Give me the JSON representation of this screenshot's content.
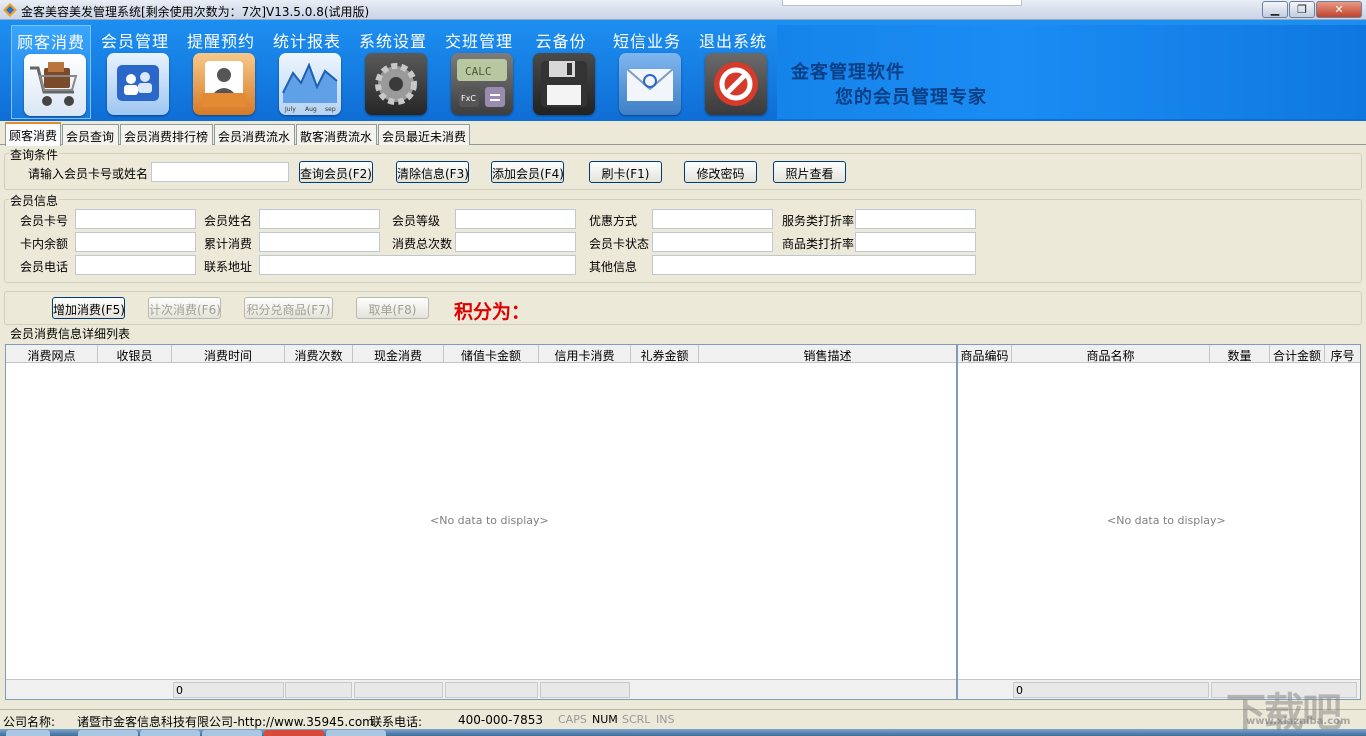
{
  "window": {
    "title": "金客美容美发管理系统[剩余使用次数为：7次]V13.5.0.8(试用版)"
  },
  "toolbar": {
    "items": [
      {
        "label": "顾客消费",
        "icon": "shopping-cart-icon"
      },
      {
        "label": "会员管理",
        "icon": "members-icon"
      },
      {
        "label": "提醒预约",
        "icon": "appointment-icon"
      },
      {
        "label": "统计报表",
        "icon": "chart-icon"
      },
      {
        "label": "系统设置",
        "icon": "gear-icon"
      },
      {
        "label": "交班管理",
        "icon": "calculator-icon"
      },
      {
        "label": "云备份",
        "icon": "floppy-disk-icon"
      },
      {
        "label": "短信业务",
        "icon": "envelope-icon"
      },
      {
        "label": "退出系统",
        "icon": "exit-icon"
      }
    ],
    "calc_text": "CALC",
    "calc_key": "FxC",
    "chart_months": [
      "July",
      "Aug",
      "sep"
    ]
  },
  "brand": {
    "line1": "金客管理软件",
    "line2": "您的会员管理专家"
  },
  "tabs": [
    "顾客消费",
    "会员查询",
    "会员消费排行榜",
    "会员消费流水",
    "散客消费流水",
    "会员最近未消费"
  ],
  "query": {
    "title": "查询条件",
    "prompt": "请输入会员卡号或姓名",
    "value": "",
    "buttons": [
      "查询会员(F2)",
      "清除信息(F3)",
      "添加会员(F4)",
      "刷卡(F1)",
      "修改密码",
      "照片查看"
    ]
  },
  "member": {
    "title": "会员信息",
    "labels": {
      "card_no": "会员卡号",
      "name": "会员姓名",
      "level": "会员等级",
      "discount_mode": "优惠方式",
      "service_rate": "服务类打折率",
      "balance": "卡内余额",
      "total_spent": "累计消费",
      "total_times": "消费总次数",
      "card_status": "会员卡状态",
      "goods_rate": "商品类打折率",
      "phone": "会员电话",
      "address": "联系地址",
      "other": "其他信息"
    }
  },
  "actions": {
    "buttons": [
      "增加消费(F5)",
      "计次消费(F6)",
      "积分兑商品(F7)",
      "取单(F8)"
    ],
    "points_label": "积分为："
  },
  "detail": {
    "title": "会员消费信息详细列表",
    "left_columns": [
      "消费网点",
      "收银员",
      "消费时间",
      "消费次数",
      "现金消费",
      "储值卡金额",
      "信用卡消费",
      "礼券金额",
      "销售描述"
    ],
    "right_columns": [
      "商品编码",
      "商品名称",
      "数量",
      "合计金额",
      "序号"
    ],
    "empty_text": "<No data to display>",
    "left_footer_value": "0",
    "right_footer_value": "0"
  },
  "status": {
    "company_label": "公司名称:",
    "company_value": "诸暨市金客信息科技有限公司-http://www.35945.com",
    "phone_label": "联系电话:",
    "phone_value": "400-000-7853",
    "indicators": [
      "CAPS",
      "NUM",
      "SCRL",
      "INS"
    ]
  },
  "watermark": {
    "text": "下载吧",
    "url": "www.xiazaiba.com"
  },
  "colors": {
    "toolbar": "#1584ea",
    "points": "#e00000",
    "tab_accent": "#e68b2c"
  }
}
